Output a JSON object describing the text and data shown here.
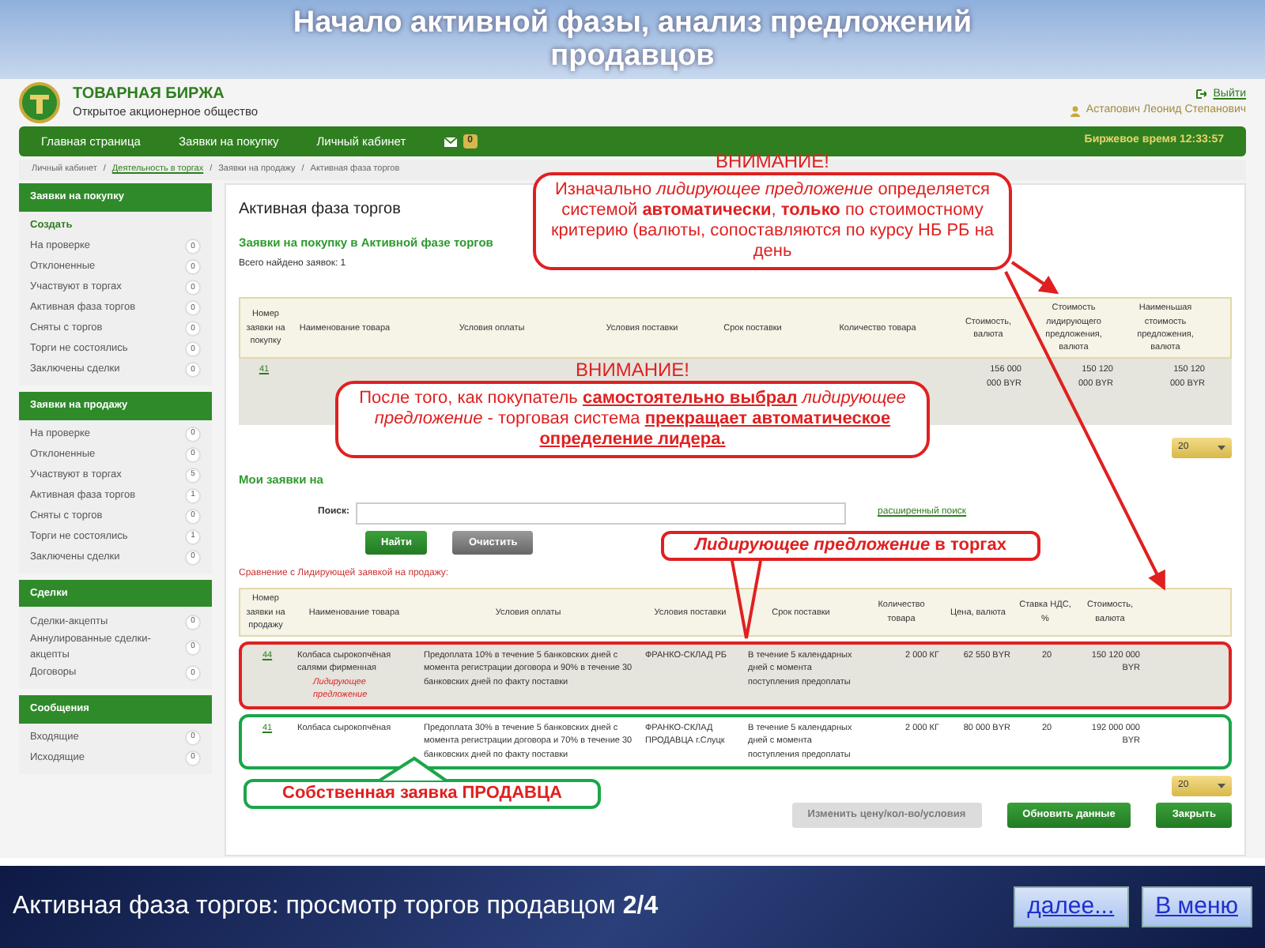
{
  "slide": {
    "title": "Начало активной фазы, анализ предложений продавцов",
    "caption": "Активная фаза торгов: просмотр торгов продавцом **2/4**",
    "buttons": [
      "далее...",
      "В меню"
    ]
  },
  "header": {
    "brand": "ТОВАРНАЯ БИРЖА",
    "subtitle": "Открытое акционерное общество",
    "logout": "Выйти",
    "user": "Астапович Леонид Степанович"
  },
  "navbar": {
    "items": [
      "Главная страница",
      "Заявки на покупку",
      "Личный кабинет"
    ],
    "messages_count": "0",
    "exchange_time": "Биржевое время 12:33:57"
  },
  "breadcrumb": [
    {
      "label": "Личный кабинет",
      "link": false
    },
    {
      "separator": "/",
      "label": "Деятельность в торгах",
      "link": true
    },
    {
      "separator": "/",
      "label": "Заявки на продажу",
      "link": false
    },
    {
      "separator": "/",
      "label": "Активная фаза торгов",
      "link": false
    }
  ],
  "sidebar": [
    {
      "title": "Заявки на покупку",
      "items": [
        {
          "label": "Создать",
          "kind": "action"
        },
        {
          "label": "На проверке",
          "count": "0",
          "kind": "counter"
        },
        {
          "label": "Отклоненные",
          "count": "0",
          "kind": "counter"
        },
        {
          "label": "Участвуют в торгах",
          "count": "0",
          "kind": "counter"
        },
        {
          "label": "Активная фаза торгов",
          "count": "0",
          "kind": "counter"
        },
        {
          "label": "Сняты с торгов",
          "count": "0",
          "kind": "counter"
        },
        {
          "label": "Торги не состоялись",
          "count": "0",
          "kind": "counter"
        },
        {
          "label": "Заключены сделки",
          "count": "0",
          "kind": "counter"
        }
      ]
    },
    {
      "title": "Заявки на продажу",
      "items": [
        {
          "label": "На проверке",
          "count": "0",
          "kind": "counter"
        },
        {
          "label": "Отклоненные",
          "count": "0",
          "kind": "counter"
        },
        {
          "label": "Участвуют в торгах",
          "count": "5",
          "kind": "counter"
        },
        {
          "label": "Активная фаза торгов",
          "count": "1",
          "kind": "counter"
        },
        {
          "label": "Сняты с торгов",
          "count": "0",
          "kind": "counter"
        },
        {
          "label": "Торги не состоялись",
          "count": "1",
          "kind": "counter"
        },
        {
          "label": "Заключены сделки",
          "count": "0",
          "kind": "counter"
        }
      ]
    },
    {
      "title": "Сделки",
      "items": [
        {
          "label": "Сделки-акцепты",
          "count": "0",
          "kind": "counter"
        },
        {
          "label": "Аннулированные сделки-акцепты",
          "count": "0",
          "kind": "counter"
        },
        {
          "label": "Договоры",
          "count": "0",
          "kind": "counter"
        }
      ]
    },
    {
      "title": "Сообщения",
      "items": [
        {
          "label": "Входящие",
          "count": "0",
          "kind": "counter"
        },
        {
          "label": "Исходящие",
          "count": "0",
          "kind": "counter"
        }
      ]
    }
  ],
  "main": {
    "title": "Активная фаза торгов",
    "buy_section": {
      "title": "Заявки на покупку в Активной фазе торгов",
      "total": "Всего найдено заявок: 1",
      "columns": [
        "Номер заявки на покупку",
        "Наименование товара",
        "Условия оплаты",
        "Условия поставки",
        "Срок поставки",
        "Количество товара",
        "Стоимость, валюта",
        "Стоимость лидирующего предложения, валюта",
        "Наименьшая стоимость предложения, валюта"
      ],
      "rows": [
        {
          "number": "41",
          "cost": "156 000 000 BYR",
          "leader_cost": "150 120 000 BYR",
          "min_cost": "150 120 000 BYR"
        }
      ],
      "page_size": "20"
    },
    "sell_section": {
      "title": "Мои заявки на",
      "search_label": "Поиск:",
      "advanced_search": "расширенный поиск",
      "buttons": [
        "Найти",
        "Очистить"
      ],
      "comparison_label": "Сравнение с Лидирующей заявкой на продажу:",
      "columns": [
        "Номер заявки на продажу",
        "Наименование товара",
        "Условия оплаты",
        "Условия поставки",
        "Срок поставки",
        "Количество товара",
        "Цена, валюта",
        "Ставка НДС, %",
        "Стоимость, валюта"
      ],
      "rows": [
        {
          "number": "44",
          "product": "Колбаса сырокопчёная салями фирменная",
          "note": "Лидирующее предложение",
          "payment": "Предоплата 10% в течение 5 банковских дней с момента регистрации договора и 90% в течение 30 банковских дней по факту поставки",
          "delivery": "ФРАНКО-СКЛАД РБ",
          "term": "В течение 5 календарных дней с момента поступления предоплаты",
          "quantity": "2 000 КГ",
          "price": "62 550 BYR",
          "vat": "20",
          "cost": "150 120 000 BYR",
          "color": "#e02020"
        },
        {
          "number": "41",
          "product": "Колбаса сырокопчёная",
          "payment": "Предоплата 30% в течение 5 банковских дней с момента регистрации договора и 70% в течение 30 банковских дней по факту поставки",
          "delivery": "ФРАНКО-СКЛАД ПРОДАВЦА г.Слуцк",
          "term": "В течение 5 календарных дней с момента поступления предоплаты",
          "quantity": "2 000 КГ",
          "price": "80 000 BYR",
          "vat": "20",
          "cost": "192 000 000 BYR",
          "color": "#1aa64a"
        }
      ],
      "page_size": "20",
      "actions": [
        {
          "label": "Изменить цену/кол-во/условия",
          "disabled": true
        },
        {
          "label": "Обновить данные",
          "disabled": false
        },
        {
          "label": "Закрыть",
          "disabled": false
        }
      ]
    }
  },
  "callouts": [
    {
      "kind": "system",
      "heading": "ВНИМАНИЕ!",
      "text": "Изначально *лидирующее предложение* определяется системой **автоматически**, **только** по стоимостному критерию (валюты, сопоставляются по курсу НБ РБ на день"
    },
    {
      "kind": "manual",
      "heading": "ВНИМАНИЕ!",
      "text": "После того, как покупатель **самостоятельно выбрал** *лидирующее предложение* - торговая система **прекращает автоматическое определение лидера.**"
    },
    {
      "kind": "leader",
      "text": "*Лидирующее предложение* в торгах"
    },
    {
      "kind": "own",
      "text": "Собственная заявка ПРОДАВЦА"
    }
  ]
}
